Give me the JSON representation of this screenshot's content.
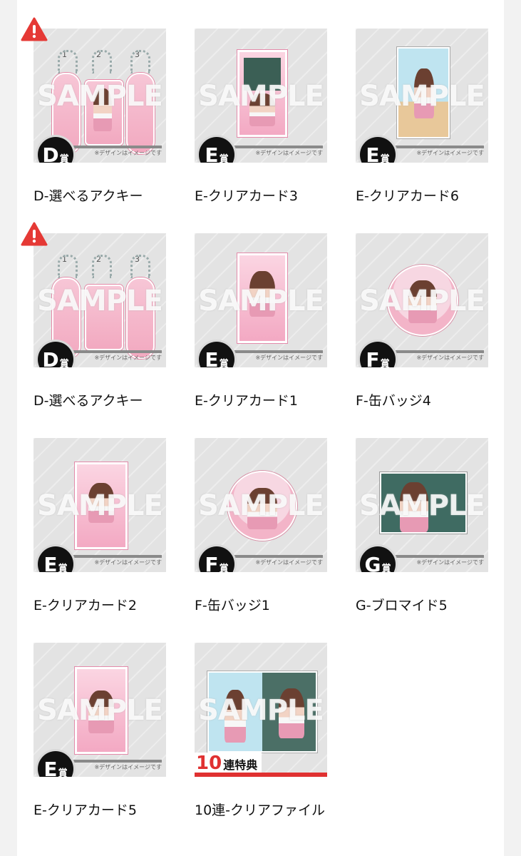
{
  "watermark": "SAMPLE",
  "note": "※デザインはイメージです",
  "badge_suffix": "賞",
  "tenren_badge": {
    "num": "10",
    "text": "連特典"
  },
  "items": [
    {
      "grade": "D",
      "label": "D-選べるアクキー",
      "warning": true
    },
    {
      "grade": "E",
      "label": "E-クリアカード3",
      "warning": false
    },
    {
      "grade": "E",
      "label": "E-クリアカード6",
      "warning": false
    },
    {
      "grade": "D",
      "label": "D-選べるアクキー",
      "warning": true
    },
    {
      "grade": "E",
      "label": "E-クリアカード1",
      "warning": false
    },
    {
      "grade": "F",
      "label": "F-缶バッジ4",
      "warning": false
    },
    {
      "grade": "E",
      "label": "E-クリアカード2",
      "warning": false
    },
    {
      "grade": "F",
      "label": "F-缶バッジ1",
      "warning": false
    },
    {
      "grade": "G",
      "label": "G-ブロマイド5",
      "warning": false
    },
    {
      "grade": "E",
      "label": "E-クリアカード5",
      "warning": false
    },
    {
      "grade": "",
      "label": "10連-クリアファイル",
      "warning": false
    }
  ],
  "keychain_numbers": [
    "1",
    "2",
    "3"
  ],
  "colors": {
    "warning": "#e53935",
    "tenren_red": "#e03131",
    "badge_bg": "#111111"
  }
}
